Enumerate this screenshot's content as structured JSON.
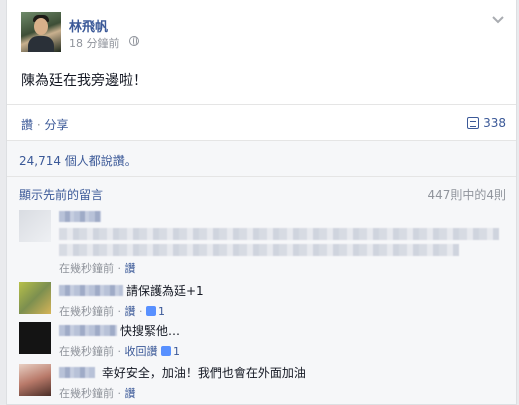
{
  "post": {
    "author": "林飛帆",
    "timestamp": "18 分鐘前",
    "privacy_icon": "globe-icon",
    "text": "陳為廷在我旁邊啦！"
  },
  "actions": {
    "like": "讚",
    "separator": " · ",
    "share": "分享",
    "share_count": "338"
  },
  "ufi": {
    "likes_text": "24,714 個人都說讚。",
    "view_previous": "顯示先前的留言",
    "comment_range": "447則中的4則"
  },
  "comments": [
    {
      "text": "",
      "time": "在幾秒鐘前",
      "like_label": "讚",
      "likes": ""
    },
    {
      "text": "請保護為廷+1",
      "time": "在幾秒鐘前",
      "like_label": "讚",
      "likes": "1"
    },
    {
      "text": "快搜緊他…",
      "time": "在幾秒鐘前",
      "unlike_label": "收回讚",
      "likes": "1"
    },
    {
      "text": "幸好安全，加油！我們也會在外面加油",
      "time": "在幾秒鐘前",
      "like_label": "讚",
      "likes": ""
    }
  ],
  "colors": {
    "link": "#3b5998",
    "muted": "#90949c",
    "ufi_bg": "#f6f7f9"
  }
}
